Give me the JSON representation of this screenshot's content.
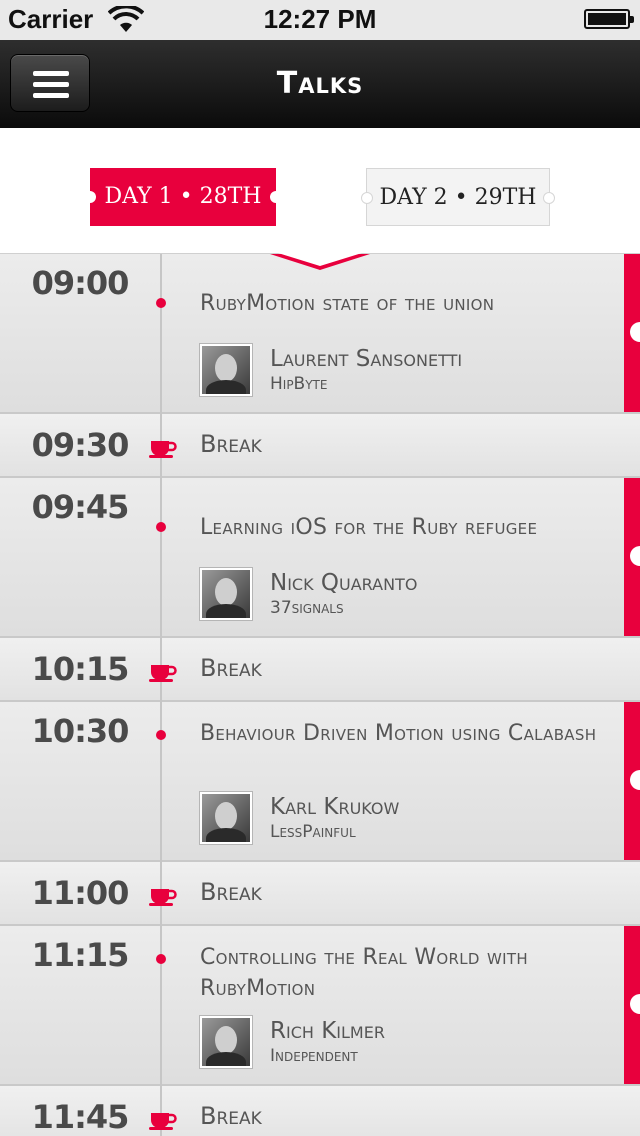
{
  "status_bar": {
    "carrier": "Carrier",
    "time": "12:27 PM"
  },
  "nav": {
    "title": "Talks",
    "menu_icon": "hamburger-menu-icon"
  },
  "day_tabs": [
    {
      "label": "DAY 1 • 28TH",
      "selected": true
    },
    {
      "label": "DAY 2 • 29TH",
      "selected": false
    }
  ],
  "colors": {
    "accent": "#e8003d",
    "nav_bg": "#111111",
    "row_bg": "#e4e4e4"
  },
  "schedule": [
    {
      "type": "talk",
      "time": "09:00",
      "title": "RubyMotion state of the union",
      "speaker": "Laurent Sansonetti",
      "company": "HipByte"
    },
    {
      "type": "break",
      "time": "09:30",
      "label": "Break",
      "icon": "coffee-cup-icon"
    },
    {
      "type": "talk",
      "time": "09:45",
      "title": "Learning iOS for the Ruby refugee",
      "speaker": "Nick Quaranto",
      "company": "37signals"
    },
    {
      "type": "break",
      "time": "10:15",
      "label": "Break",
      "icon": "coffee-cup-icon"
    },
    {
      "type": "talk",
      "time": "10:30",
      "title": "Behaviour Driven Motion using Calabash",
      "speaker": "Karl Krukow",
      "company": "LessPainful"
    },
    {
      "type": "break",
      "time": "11:00",
      "label": "Break",
      "icon": "coffee-cup-icon"
    },
    {
      "type": "talk",
      "time": "11:15",
      "title": "Controlling the Real World with RubyMotion",
      "speaker": "Rich Kilmer",
      "company": "Independent"
    },
    {
      "type": "break",
      "time": "11:45",
      "label": "Break",
      "icon": "coffee-cup-icon"
    }
  ]
}
